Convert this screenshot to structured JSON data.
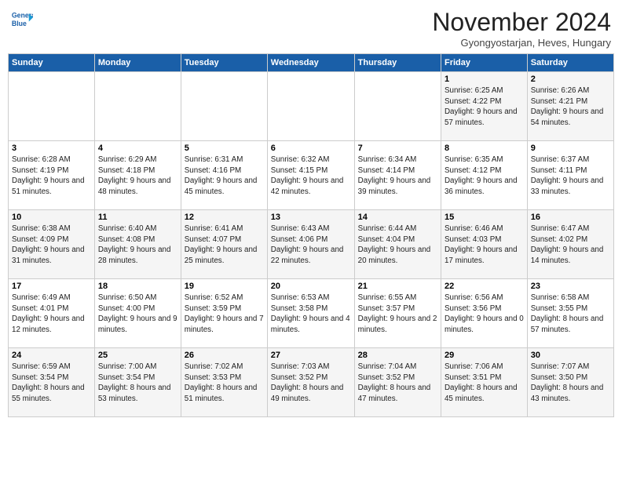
{
  "header": {
    "logo_line1": "General",
    "logo_line2": "Blue",
    "month_title": "November 2024",
    "location": "Gyongyostarjan, Heves, Hungary"
  },
  "days_of_week": [
    "Sunday",
    "Monday",
    "Tuesday",
    "Wednesday",
    "Thursday",
    "Friday",
    "Saturday"
  ],
  "weeks": [
    [
      {
        "day": "",
        "info": ""
      },
      {
        "day": "",
        "info": ""
      },
      {
        "day": "",
        "info": ""
      },
      {
        "day": "",
        "info": ""
      },
      {
        "day": "",
        "info": ""
      },
      {
        "day": "1",
        "info": "Sunrise: 6:25 AM\nSunset: 4:22 PM\nDaylight: 9 hours and 57 minutes."
      },
      {
        "day": "2",
        "info": "Sunrise: 6:26 AM\nSunset: 4:21 PM\nDaylight: 9 hours and 54 minutes."
      }
    ],
    [
      {
        "day": "3",
        "info": "Sunrise: 6:28 AM\nSunset: 4:19 PM\nDaylight: 9 hours and 51 minutes."
      },
      {
        "day": "4",
        "info": "Sunrise: 6:29 AM\nSunset: 4:18 PM\nDaylight: 9 hours and 48 minutes."
      },
      {
        "day": "5",
        "info": "Sunrise: 6:31 AM\nSunset: 4:16 PM\nDaylight: 9 hours and 45 minutes."
      },
      {
        "day": "6",
        "info": "Sunrise: 6:32 AM\nSunset: 4:15 PM\nDaylight: 9 hours and 42 minutes."
      },
      {
        "day": "7",
        "info": "Sunrise: 6:34 AM\nSunset: 4:14 PM\nDaylight: 9 hours and 39 minutes."
      },
      {
        "day": "8",
        "info": "Sunrise: 6:35 AM\nSunset: 4:12 PM\nDaylight: 9 hours and 36 minutes."
      },
      {
        "day": "9",
        "info": "Sunrise: 6:37 AM\nSunset: 4:11 PM\nDaylight: 9 hours and 33 minutes."
      }
    ],
    [
      {
        "day": "10",
        "info": "Sunrise: 6:38 AM\nSunset: 4:09 PM\nDaylight: 9 hours and 31 minutes."
      },
      {
        "day": "11",
        "info": "Sunrise: 6:40 AM\nSunset: 4:08 PM\nDaylight: 9 hours and 28 minutes."
      },
      {
        "day": "12",
        "info": "Sunrise: 6:41 AM\nSunset: 4:07 PM\nDaylight: 9 hours and 25 minutes."
      },
      {
        "day": "13",
        "info": "Sunrise: 6:43 AM\nSunset: 4:06 PM\nDaylight: 9 hours and 22 minutes."
      },
      {
        "day": "14",
        "info": "Sunrise: 6:44 AM\nSunset: 4:04 PM\nDaylight: 9 hours and 20 minutes."
      },
      {
        "day": "15",
        "info": "Sunrise: 6:46 AM\nSunset: 4:03 PM\nDaylight: 9 hours and 17 minutes."
      },
      {
        "day": "16",
        "info": "Sunrise: 6:47 AM\nSunset: 4:02 PM\nDaylight: 9 hours and 14 minutes."
      }
    ],
    [
      {
        "day": "17",
        "info": "Sunrise: 6:49 AM\nSunset: 4:01 PM\nDaylight: 9 hours and 12 minutes."
      },
      {
        "day": "18",
        "info": "Sunrise: 6:50 AM\nSunset: 4:00 PM\nDaylight: 9 hours and 9 minutes."
      },
      {
        "day": "19",
        "info": "Sunrise: 6:52 AM\nSunset: 3:59 PM\nDaylight: 9 hours and 7 minutes."
      },
      {
        "day": "20",
        "info": "Sunrise: 6:53 AM\nSunset: 3:58 PM\nDaylight: 9 hours and 4 minutes."
      },
      {
        "day": "21",
        "info": "Sunrise: 6:55 AM\nSunset: 3:57 PM\nDaylight: 9 hours and 2 minutes."
      },
      {
        "day": "22",
        "info": "Sunrise: 6:56 AM\nSunset: 3:56 PM\nDaylight: 9 hours and 0 minutes."
      },
      {
        "day": "23",
        "info": "Sunrise: 6:58 AM\nSunset: 3:55 PM\nDaylight: 8 hours and 57 minutes."
      }
    ],
    [
      {
        "day": "24",
        "info": "Sunrise: 6:59 AM\nSunset: 3:54 PM\nDaylight: 8 hours and 55 minutes."
      },
      {
        "day": "25",
        "info": "Sunrise: 7:00 AM\nSunset: 3:54 PM\nDaylight: 8 hours and 53 minutes."
      },
      {
        "day": "26",
        "info": "Sunrise: 7:02 AM\nSunset: 3:53 PM\nDaylight: 8 hours and 51 minutes."
      },
      {
        "day": "27",
        "info": "Sunrise: 7:03 AM\nSunset: 3:52 PM\nDaylight: 8 hours and 49 minutes."
      },
      {
        "day": "28",
        "info": "Sunrise: 7:04 AM\nSunset: 3:52 PM\nDaylight: 8 hours and 47 minutes."
      },
      {
        "day": "29",
        "info": "Sunrise: 7:06 AM\nSunset: 3:51 PM\nDaylight: 8 hours and 45 minutes."
      },
      {
        "day": "30",
        "info": "Sunrise: 7:07 AM\nSunset: 3:50 PM\nDaylight: 8 hours and 43 minutes."
      }
    ]
  ]
}
